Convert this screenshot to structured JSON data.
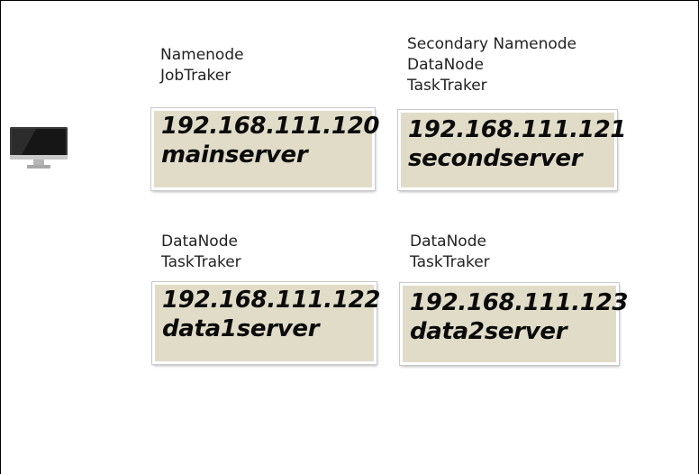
{
  "nodes": [
    {
      "roles": [
        "Namenode",
        "JobTraker"
      ],
      "ip": "192.168.111.120",
      "hostname": "mainserver"
    },
    {
      "roles": [
        "Secondary Namenode",
        "DataNode",
        "TaskTraker"
      ],
      "ip": "192.168.111.121",
      "hostname": "secondserver"
    },
    {
      "roles": [
        "DataNode",
        "TaskTraker"
      ],
      "ip": "192.168.111.122",
      "hostname": "data1server"
    },
    {
      "roles": [
        "DataNode",
        "TaskTraker"
      ],
      "ip": "192.168.111.123",
      "hostname": "data2server"
    }
  ],
  "icons": {
    "monitor": "desktop-monitor-icon"
  },
  "colors": {
    "box_fill": "#e1dcc8",
    "text": "#0b0b0b"
  }
}
